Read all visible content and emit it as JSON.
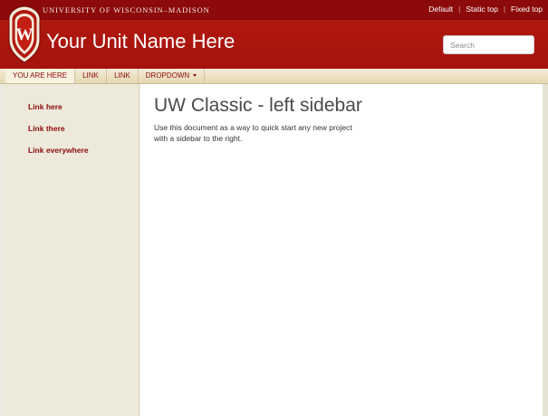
{
  "topbar": {
    "university_name": "UNIVERSITY OF WISCONSIN–MADISON",
    "links": [
      "Default",
      "Static top",
      "Fixed top"
    ]
  },
  "header": {
    "site_title": "Your Unit Name Here",
    "search_placeholder": "Search",
    "crest_letter": "W"
  },
  "nav": {
    "items": [
      "YOU ARE HERE",
      "LINK",
      "LINK",
      "DROPDOWN"
    ]
  },
  "sidebar": {
    "links": [
      "Link here",
      "Link there",
      "Link everywhere"
    ]
  },
  "main": {
    "title": "UW Classic - left sidebar",
    "lead_line1": "Use this document as a way to quick start any new project",
    "lead_line2": "with a sidebar to the right."
  },
  "colors": {
    "uw_red": "#a5130d",
    "topbar_red": "#8c0a0a",
    "sidebar_bg": "#edeadb"
  }
}
